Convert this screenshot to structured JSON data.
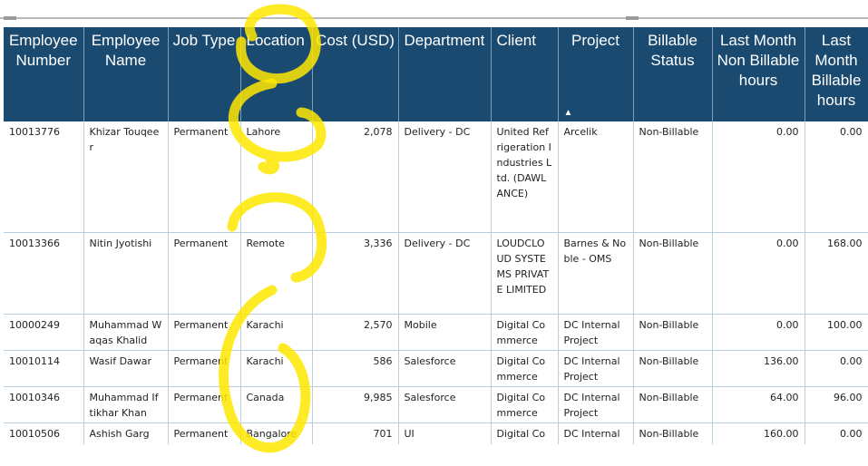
{
  "table": {
    "columns": [
      {
        "label": "Employee Number"
      },
      {
        "label": "Employee Name"
      },
      {
        "label": "Job Type"
      },
      {
        "label": "Location"
      },
      {
        "label": "Cost (USD)"
      },
      {
        "label": "Department"
      },
      {
        "label": "Client"
      },
      {
        "label": "Project",
        "sort": "▲"
      },
      {
        "label": "Billable Status"
      },
      {
        "label": "Last Month Non Billable hours"
      },
      {
        "label": "Last Month Billable hours"
      }
    ],
    "rows": [
      {
        "cells": [
          "10013776",
          "Khizar Touqeer",
          "Permanent",
          "Lahore",
          "2,078",
          "Delivery - DC",
          "United Refrigeration Industries Ltd. (DAWLANCE)",
          "Arcelik",
          "Non-Billable",
          "0.00",
          "0.00"
        ]
      },
      {
        "cells": [
          "10013366",
          "Nitin Jyotishi",
          "Permanent",
          "Remote",
          "3,336",
          "Delivery - DC",
          "LOUDCLOUD SYSTEMS PRIVATE LIMITED",
          "Barnes & Noble - OMS",
          "Non-Billable",
          "0.00",
          "168.00"
        ]
      },
      {
        "cells": [
          "10000249",
          "Muhammad Waqas Khalid",
          "Permanent",
          "Karachi",
          "2,570",
          "Mobile",
          "Digital Commerce",
          "DC Internal Project",
          "Non-Billable",
          "0.00",
          "100.00"
        ]
      },
      {
        "cells": [
          "10010114",
          "Wasif Dawar",
          "Permanent",
          "Karachi",
          "586",
          "Salesforce",
          "Digital Commerce",
          "DC Internal Project",
          "Non-Billable",
          "136.00",
          "0.00"
        ]
      },
      {
        "cells": [
          "10010346",
          "Muhammad Iftikhar Khan",
          "Permanent",
          "Canada",
          "9,985",
          "Salesforce",
          "Digital Commerce",
          "DC Internal Project",
          "Non-Billable",
          "64.00",
          "96.00"
        ]
      },
      {
        "cells": [
          "10010506",
          "Ashish Garg",
          "Permanent",
          "Bangalore",
          "701",
          "UI",
          "Digital Commerce",
          "DC Internal Project",
          "Non-Billable",
          "160.00",
          "0.00"
        ]
      }
    ]
  },
  "colors": {
    "header_bg": "#1b4a70",
    "header_text": "#ffffff",
    "grid": "#b9d0e3",
    "annotation": "#ffe600"
  }
}
